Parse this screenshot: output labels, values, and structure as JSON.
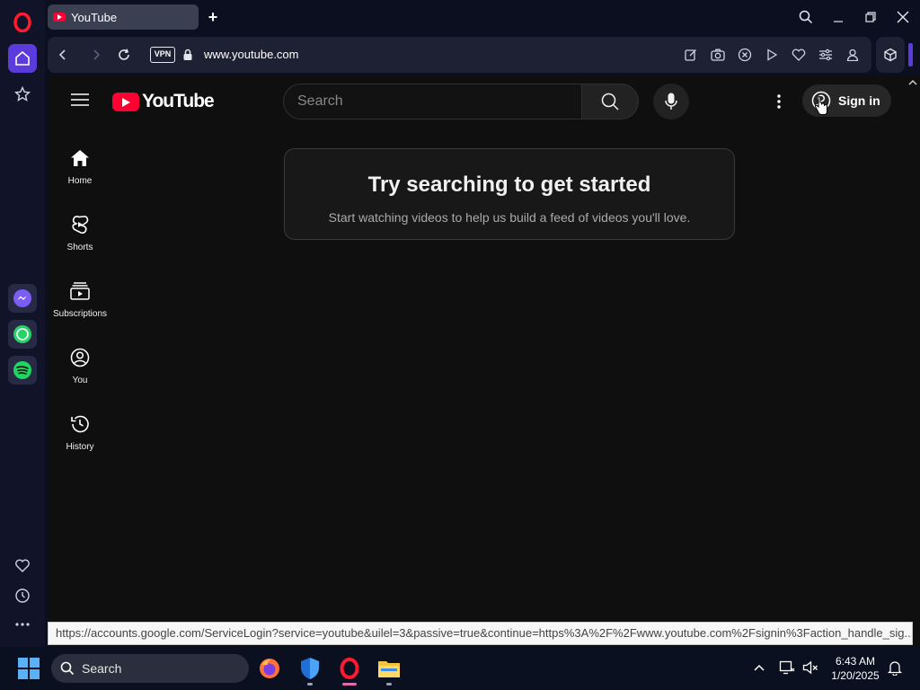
{
  "browser": {
    "tab": {
      "title": "YouTube"
    },
    "address": {
      "vpn_label": "VPN",
      "url": "www.youtube.com"
    }
  },
  "youtube": {
    "logo_text": "YouTube",
    "search": {
      "placeholder": "Search"
    },
    "signin_label": "Sign in",
    "guide": [
      {
        "label": "Home",
        "icon": "home-icon"
      },
      {
        "label": "Shorts",
        "icon": "shorts-icon"
      },
      {
        "label": "Subscriptions",
        "icon": "subscriptions-icon"
      },
      {
        "label": "You",
        "icon": "you-icon"
      },
      {
        "label": "History",
        "icon": "history-icon"
      }
    ],
    "promo": {
      "title": "Try searching to get started",
      "body": "Start watching videos to help us build a feed of videos you'll love."
    }
  },
  "status_bar": {
    "url": "https://accounts.google.com/ServiceLogin?service=youtube&uilel=3&passive=true&continue=https%3A%2F%2Fwww.youtube.com%2Fsignin%3Faction_handle_sig..."
  },
  "taskbar": {
    "search_label": "Search",
    "time": "6:43 AM",
    "date": "1/20/2025"
  },
  "colors": {
    "youtube_red": "#ff0033",
    "opera_accent": "#5b3bdc",
    "opera_red": "#ff1b2d"
  }
}
